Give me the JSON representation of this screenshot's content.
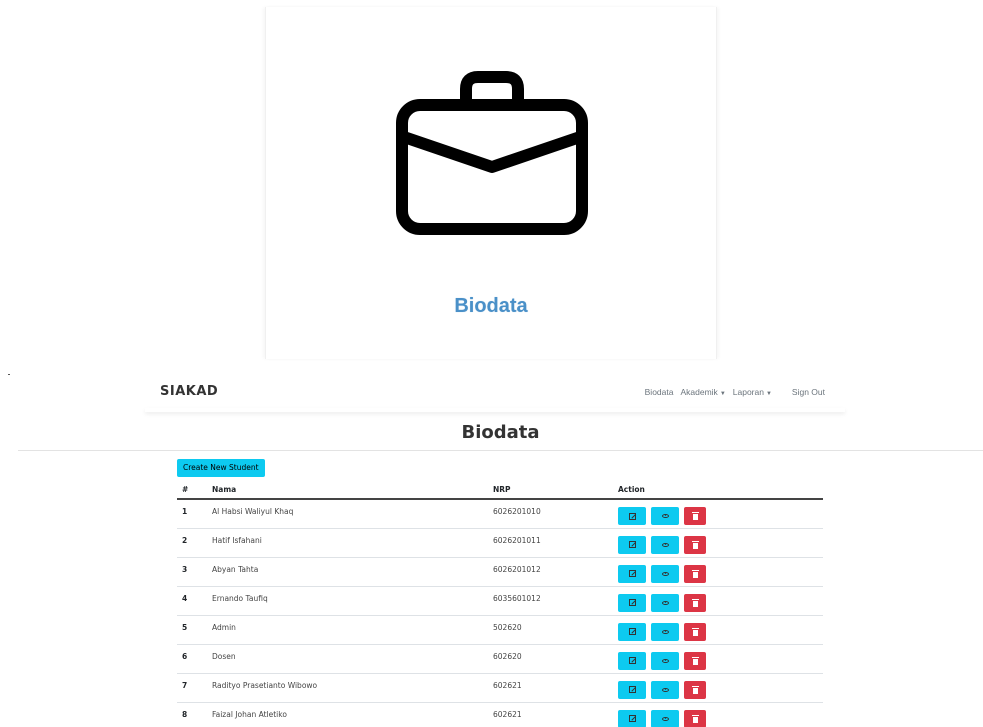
{
  "hero": {
    "icon": "briefcase-icon",
    "title": "Biodata"
  },
  "navbar": {
    "brand": "SIAKAD",
    "links": [
      {
        "label": "Biodata",
        "dropdown": false
      },
      {
        "label": "Akademik",
        "dropdown": true
      },
      {
        "label": "Laporan",
        "dropdown": true
      }
    ],
    "signout": "Sign Out"
  },
  "page": {
    "title": "Biodata",
    "create_button": "Create New Student"
  },
  "table": {
    "headers": [
      "#",
      "Nama",
      "NRP",
      "Action"
    ],
    "rows": [
      {
        "no": "1",
        "nama": "Al Habsi Waliyul Khaq",
        "nrp": "6026201010"
      },
      {
        "no": "2",
        "nama": "Hatif Isfahani",
        "nrp": "6026201011"
      },
      {
        "no": "3",
        "nama": "Abyan Tahta",
        "nrp": "6026201012"
      },
      {
        "no": "4",
        "nama": "Ernando Taufiq",
        "nrp": "6035601012"
      },
      {
        "no": "5",
        "nama": "Admin",
        "nrp": "502620"
      },
      {
        "no": "6",
        "nama": "Dosen",
        "nrp": "602620"
      },
      {
        "no": "7",
        "nama": "Radityo Prasetianto Wibowo",
        "nrp": "602621"
      },
      {
        "no": "8",
        "nama": "Faizal Johan Atletiko",
        "nrp": "602621"
      }
    ],
    "actions": [
      {
        "name": "edit",
        "icon": "edit-icon",
        "color": "#0dcaf0"
      },
      {
        "name": "view",
        "icon": "eye-icon",
        "color": "#0dcaf0"
      },
      {
        "name": "delete",
        "icon": "trash-icon",
        "color": "#dc3545"
      }
    ]
  },
  "colors": {
    "accent": "#0dcaf0",
    "danger": "#dc3545",
    "hero_title": "#4a90c8"
  }
}
